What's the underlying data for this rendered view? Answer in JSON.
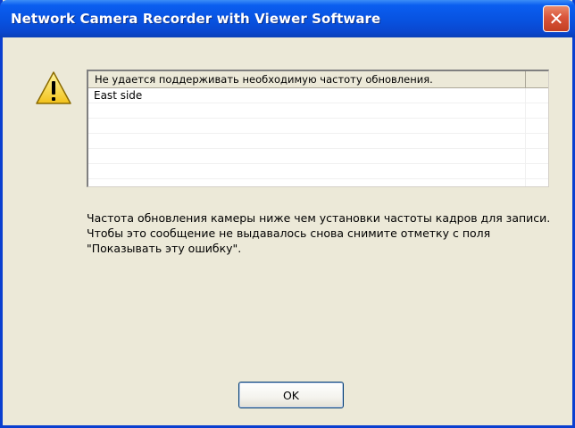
{
  "window": {
    "title": "Network Camera Recorder with Viewer Software",
    "close_glyph": "✕"
  },
  "icon": {
    "name": "warning-icon"
  },
  "list": {
    "header": "Не удается поддерживать необходимую частоту обновления.",
    "rows": [
      "East side",
      "",
      "",
      "",
      "",
      "",
      ""
    ]
  },
  "message": {
    "line1": "Частота обновления камеры ниже чем установки частоты кадров для записи.",
    "line2": "Чтобы это сообщение не выдавалось снова снимите отметку с поля \"Показывать эту ошибку\"."
  },
  "buttons": {
    "ok_label": "OK"
  },
  "colors": {
    "titlebar": "#0852e0",
    "close_button": "#d9543a",
    "background": "#ece9d8"
  }
}
